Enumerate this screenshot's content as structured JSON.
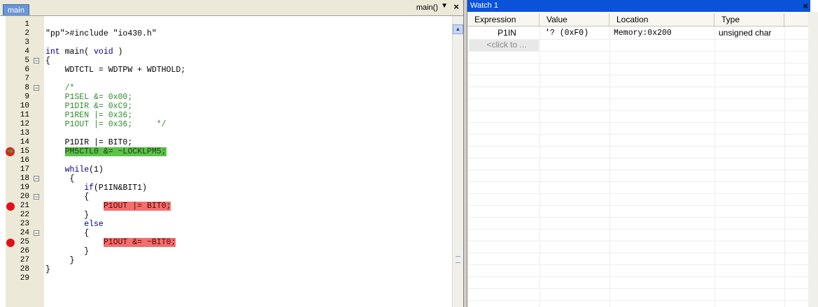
{
  "editor": {
    "tab_label": "main",
    "function_select": "main()",
    "dropdown_glyph": "▼",
    "close_glyph": "×",
    "lines": [
      {
        "n": "1",
        "code": ""
      },
      {
        "n": "2",
        "code": "#include \"io430.h\""
      },
      {
        "n": "3",
        "code": ""
      },
      {
        "n": "4",
        "code": "int main( void )"
      },
      {
        "n": "5",
        "code": "{",
        "fold": "−"
      },
      {
        "n": "6",
        "code": "    WDTCTL = WDTPW + WDTHOLD;"
      },
      {
        "n": "7",
        "code": ""
      },
      {
        "n": "8",
        "code": "    /*",
        "fold": "−"
      },
      {
        "n": "9",
        "code": "    P1SEL &= 0x00;"
      },
      {
        "n": "10",
        "code": "    P1DIR &= 0xC9;"
      },
      {
        "n": "11",
        "code": "    P1REN |= 0x36;"
      },
      {
        "n": "12",
        "code": "    P1OUT |= 0x36;     */"
      },
      {
        "n": "13",
        "code": ""
      },
      {
        "n": "14",
        "code": "    P1DIR |= BIT0;"
      },
      {
        "n": "15",
        "code": "    PM5CTL0 &= ~LOCKLPM5;",
        "marker": "pc"
      },
      {
        "n": "16",
        "code": ""
      },
      {
        "n": "17",
        "code": "    while(1)"
      },
      {
        "n": "18",
        "code": "     {",
        "fold": "−"
      },
      {
        "n": "19",
        "code": "        if(P1IN&BIT1)"
      },
      {
        "n": "20",
        "code": "        {",
        "fold": "−"
      },
      {
        "n": "21",
        "code": "            P1OUT |= BIT0;",
        "marker": "bp"
      },
      {
        "n": "22",
        "code": "        }"
      },
      {
        "n": "23",
        "code": "        else"
      },
      {
        "n": "24",
        "code": "        {",
        "fold": "−"
      },
      {
        "n": "25",
        "code": "            P1OUT &= ~BIT0;",
        "marker": "bp"
      },
      {
        "n": "26",
        "code": "        }"
      },
      {
        "n": "27",
        "code": "     }"
      },
      {
        "n": "28",
        "code": "}"
      },
      {
        "n": "29",
        "code": ""
      }
    ],
    "colors": {
      "current_line": "#5cc44a",
      "breakpoint_line": "#f26f6f",
      "breakpoint_dot": "#e0101a"
    }
  },
  "watch": {
    "title": "Watch 1",
    "close_glyph": "×",
    "columns": [
      "Expression",
      "Value",
      "Location",
      "Type"
    ],
    "rows": [
      {
        "expression": "P1IN",
        "value": "'? (0xF0)",
        "location": "Memory:0x200",
        "type": "unsigned char"
      }
    ],
    "add_placeholder": "<click to ..."
  }
}
